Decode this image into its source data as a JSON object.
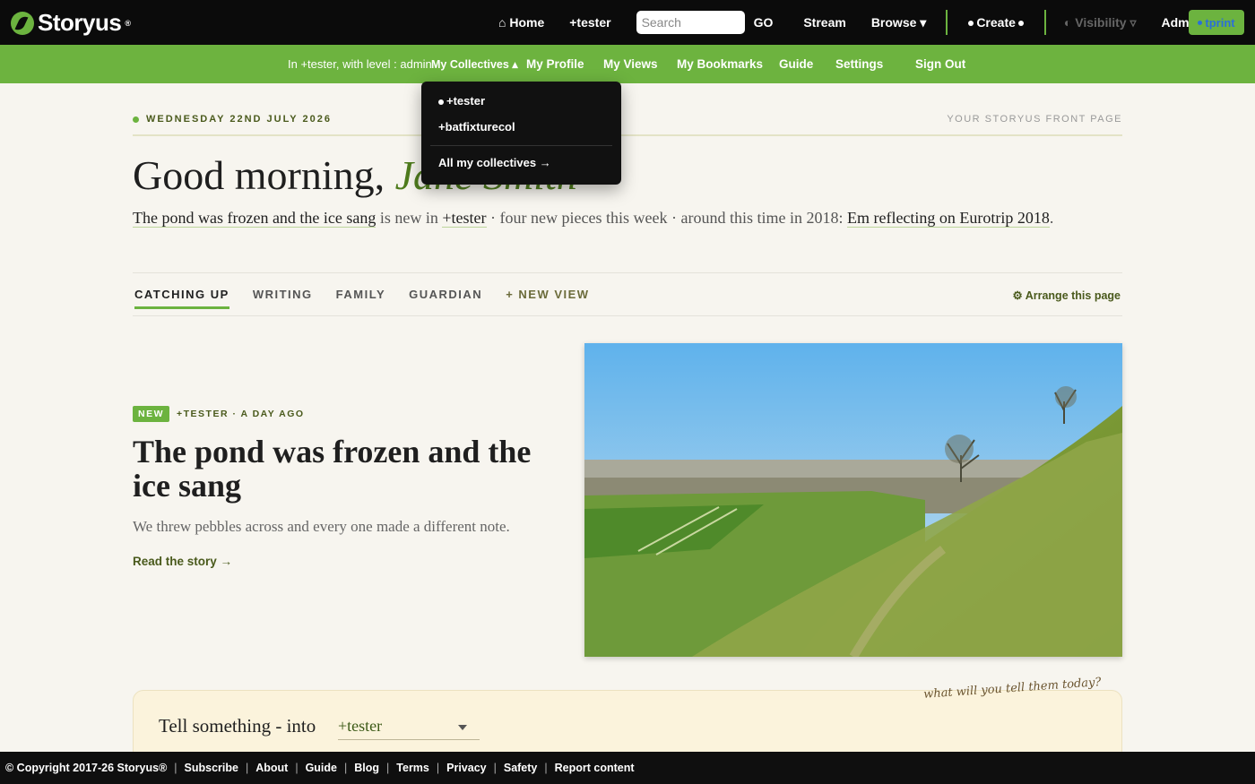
{
  "app": {
    "logo_text": "Storyus",
    "logo_mark": "®"
  },
  "topnav": {
    "home": "⌂ Home",
    "tester": "+tester",
    "search_placeholder": "Search",
    "go": "GO",
    "stream": "Stream",
    "browse": "Browse ▾",
    "create": "Create",
    "visibility": "Visibility ▿",
    "admin": "Admin ▿",
    "user": "tprint"
  },
  "subnav": {
    "status": "In +tester, with level : admin",
    "collectives": "My Collectives ▴",
    "profile": "My Profile",
    "views": "My Views",
    "bookmarks": "My Bookmarks",
    "guide": "Guide",
    "settings": "Settings",
    "signout": "Sign Out"
  },
  "dropdown": {
    "item1": "+tester",
    "item2": "+batfixturecol",
    "all": "All my collectives →"
  },
  "main": {
    "date": "WEDNESDAY 22ND JULY 2026",
    "frontpage_label": "YOUR STORYUS FRONT PAGE",
    "greeting": "Good morning,",
    "greeting_name": "Jane Smith",
    "summary": {
      "story_link": "The pond was frozen and the ice sang",
      "is_new_in": " is new in ",
      "collective": "+tester",
      "rest": " · four new pieces this week · around this time in 2018: ",
      "memory_link": "Em reflecting on Eurotrip 2018",
      "end": "."
    },
    "tabs": [
      "CATCHING UP",
      "WRITING",
      "FAMILY",
      "GUARDIAN",
      "+ NEW VIEW"
    ],
    "arrange": "⚙ Arrange this page"
  },
  "story": {
    "badge": "NEW",
    "meta": "+TESTER · A DAY AGO",
    "title": "The pond was frozen and the ice sang",
    "subtitle": "We threw pebbles across and every one made a different note.",
    "read_link": "Read the story →"
  },
  "compose": {
    "label": "Tell something - into",
    "collective": "+tester",
    "prompt": "what will you tell them today?"
  },
  "footer": {
    "copyright": "© Copyright 2017-26 Storyus®",
    "links": [
      "Subscribe",
      "About",
      "Guide",
      "Blog",
      "Terms",
      "Privacy",
      "Safety",
      "Report content"
    ]
  },
  "colors": {
    "accent_green": "#6db33f",
    "dark": "#0b0b0b",
    "compose_bg": "#fbf3dc"
  }
}
